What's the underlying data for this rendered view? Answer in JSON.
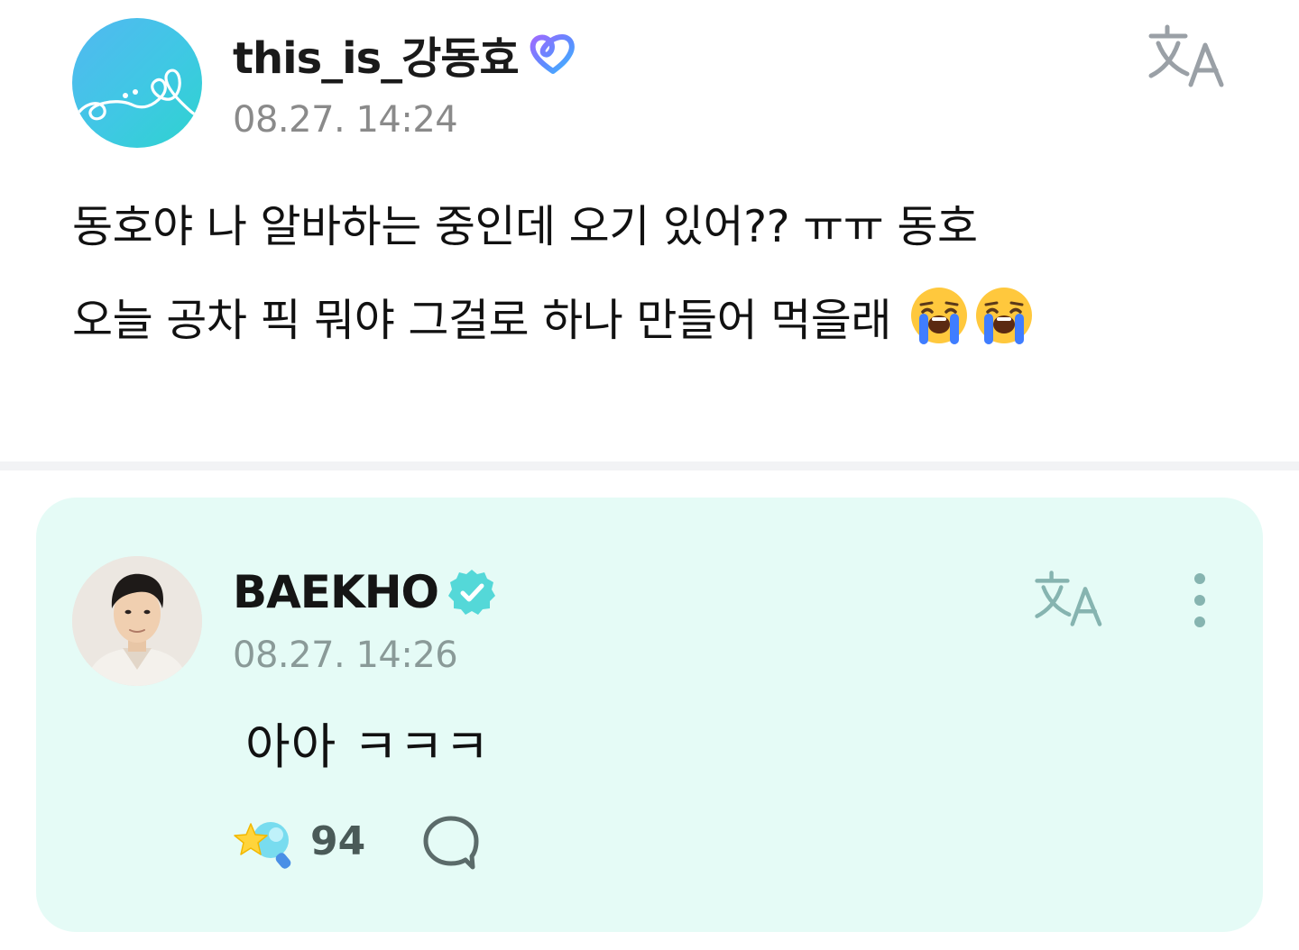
{
  "post": {
    "author": "this_is_강동효",
    "timestamp": "08.27. 14:24",
    "text_lines": [
      "동호야 나 알바하는 중인데 오기 있어?? ㅠㅠ 동호",
      "오늘 공차 픽 뭐야 그걸로 하나 만들어 먹을래"
    ],
    "trailing_emoji": [
      "loudly-crying-face",
      "loudly-crying-face"
    ],
    "badge_icon": "membership-heart-icon",
    "translate_icon": "translate-icon"
  },
  "reply": {
    "author": "BAEKHO",
    "timestamp": "08.27. 14:26",
    "text": "아아 ㅋㅋㅋ",
    "badge_icon": "verified-badge-icon",
    "like_count": "94",
    "like_icon": "star-lightstick-icon",
    "comment_icon": "comment-bubble-icon",
    "more_icon": "more-vertical-icon"
  },
  "colors": {
    "card_background": "#e5fbf6",
    "accent": "#54d8d8",
    "timestamp": "#8a8a8a",
    "avatar_gradient": [
      "#52b8f1",
      "#2ed3cf"
    ]
  }
}
